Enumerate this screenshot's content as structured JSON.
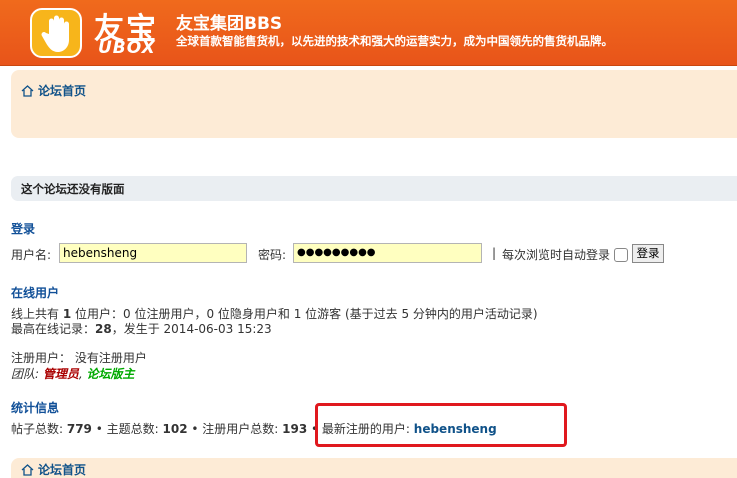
{
  "header": {
    "logo_cn": "友宝",
    "logo_en": "UBOX",
    "title": "友宝集团BBS",
    "description": "全球首款智能售货机，以先进的技术和强大的运营实力，成为中国领先的售货机品牌。"
  },
  "nav": {
    "home_label": "论坛首页"
  },
  "notice": "这个论坛还没有版面",
  "login": {
    "title": "登录",
    "username_label": "用户名:",
    "username_value": "hebensheng",
    "password_label": "密码:",
    "password_value": "●●●●●●●●●",
    "separator": "|",
    "auto_login_label": "每次浏览时自动登录",
    "submit_label": "登录"
  },
  "online": {
    "title": "在线用户",
    "line1_a": "线上共有 ",
    "total": "1",
    "line1_b": " 位用户：0 位注册用户，0 位隐身用户和 1 位游客 (基于过去 5 分钟内的用户活动记录)",
    "line2_a": "最高在线记录：",
    "record": "28",
    "line2_b": "，发生于 2014-06-03 15:23",
    "registered_line": "注册用户：  没有注册用户",
    "team_label": "团队: ",
    "team_admin": "管理员",
    "team_sep": ", ",
    "team_mod": "论坛版主"
  },
  "stats": {
    "title": "统计信息",
    "posts_label": "帖子总数: ",
    "posts": "779",
    "topics_label": " • 主题总数: ",
    "topics": "102",
    "users_label": " • 注册用户总数: ",
    "users": "193",
    "newest_label": " • 最新注册的用户: ",
    "newest_user": "hebensheng"
  },
  "footer": {
    "home_label": "论坛首页"
  },
  "colors": {
    "header_bg": "#e8541a",
    "nav_bg": "#fdebd6",
    "link": "#105289",
    "admin": "#aa0000",
    "moderator": "#00aa00",
    "highlight": "#e0181e"
  }
}
